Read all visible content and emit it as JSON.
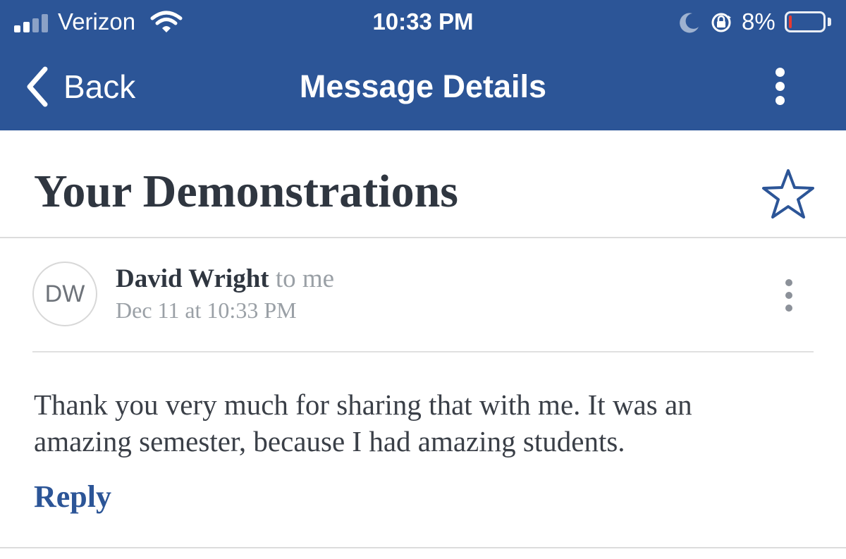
{
  "status_bar": {
    "carrier": "Verizon",
    "time": "10:33 PM",
    "battery_percent": "8%",
    "battery_level": 0.08,
    "icons": [
      "signal-icon",
      "wifi-icon",
      "do-not-disturb-moon-icon",
      "orientation-lock-icon",
      "battery-icon"
    ]
  },
  "nav": {
    "back_label": "Back",
    "title": "Message Details",
    "back_icon": "chevron-left-icon",
    "more_icon": "vertical-ellipsis-icon"
  },
  "message": {
    "subject": "Your Demonstrations",
    "star_icon": "star-outline-icon",
    "sender_initials": "DW",
    "sender_name": "David Wright",
    "recipient": "to me",
    "date": "Dec 11 at 10:33 PM",
    "body_lines": [
      "Thank you very much for sharing that with me.  It was an",
      "amazing semester, because I had amazing students."
    ],
    "reply_label": "Reply"
  },
  "colors": {
    "header_blue": "#2c5597",
    "battery_low": "#e83a30",
    "title_text": "#2f3640",
    "muted_text": "#9aa0a6"
  }
}
